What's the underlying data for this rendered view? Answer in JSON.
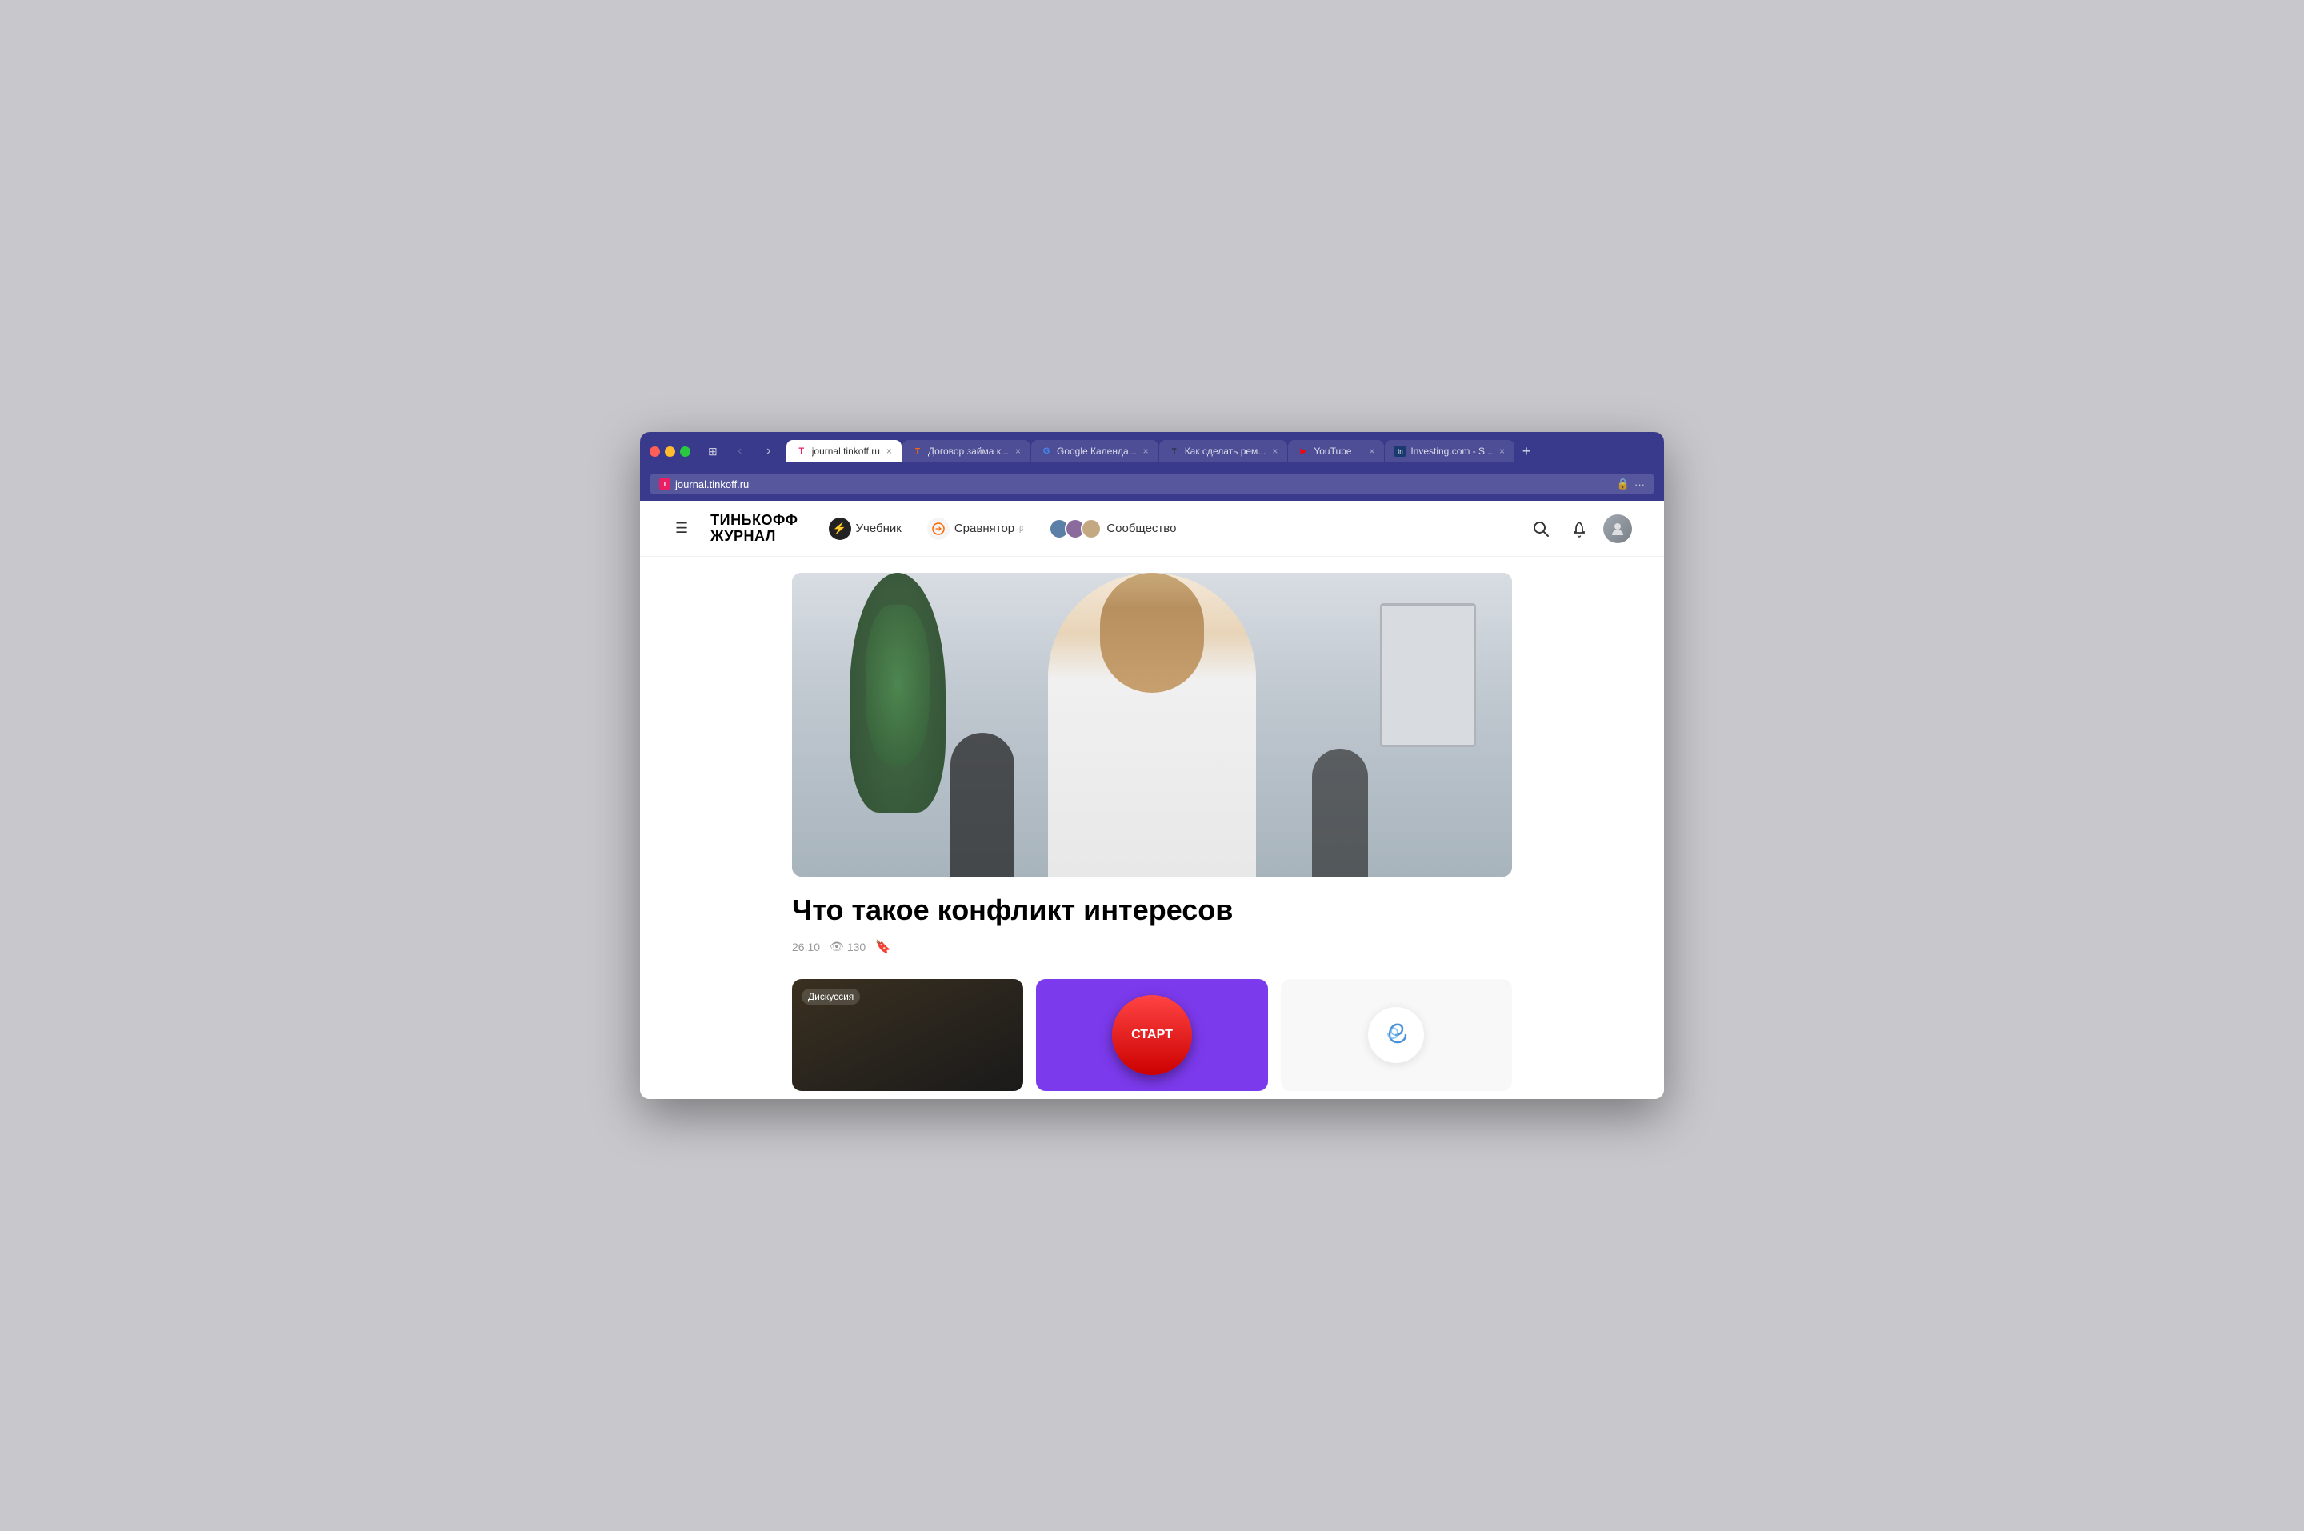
{
  "browser": {
    "tabs": [
      {
        "id": "tab-journal",
        "favicon_type": "x",
        "favicon_text": "Т",
        "label": "journal.tinkoff.ru",
        "active": true,
        "url": "journal.tinkoff.ru",
        "has_lock": true,
        "more": "···"
      },
      {
        "id": "tab-dogovor",
        "favicon_type": "tj",
        "favicon_text": "Т",
        "label": "Договор займа к...",
        "active": false
      },
      {
        "id": "tab-google",
        "favicon_type": "g",
        "favicon_text": "G",
        "label": "Google Календа...",
        "active": false
      },
      {
        "id": "tab-kak",
        "favicon_type": "tj2",
        "favicon_text": "Т",
        "label": "Как сделать рем...",
        "active": false
      },
      {
        "id": "tab-youtube",
        "favicon_type": "yt",
        "favicon_text": "▶",
        "label": "YouTube",
        "active": false
      },
      {
        "id": "tab-investing",
        "favicon_type": "inv",
        "favicon_text": "In",
        "label": "Investing.com - S...",
        "active": false
      }
    ],
    "new_tab_label": "+",
    "back_disabled": true,
    "forward_disabled": false
  },
  "site": {
    "logo_line1": "ТИНЬКОФФ",
    "logo_line2": "ЖУРНАЛ",
    "hamburger_label": "☰",
    "nav": [
      {
        "id": "nav-uchebnik",
        "icon_type": "bolt",
        "icon_char": "⚡",
        "label": "Учебник"
      },
      {
        "id": "nav-sravnyator",
        "icon_type": "compare",
        "icon_char": "⇄",
        "label": "Сравнятор",
        "sup": "β"
      },
      {
        "id": "nav-soobshchestvo",
        "icon_type": "avatars",
        "label": "Сообщество"
      }
    ],
    "header_actions": {
      "search_label": "🔍",
      "bell_label": "🔔",
      "user_label": "👤"
    }
  },
  "article": {
    "title": "Что такое конфликт интересов",
    "date": "26.10",
    "views": "130",
    "views_icon": "👁"
  },
  "cards": [
    {
      "id": "card-diskussiya",
      "type": "dark",
      "label": "Дискуссия"
    },
    {
      "id": "card-start",
      "type": "purple",
      "button_text": "СТАРТ"
    },
    {
      "id": "card-spiral",
      "type": "white"
    }
  ]
}
